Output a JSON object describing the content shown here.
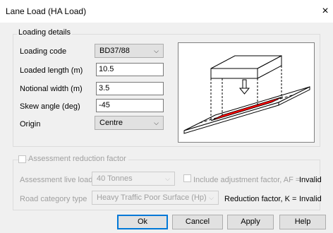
{
  "window": {
    "title": "Lane Load (HA Load)",
    "close_glyph": "×"
  },
  "loading_details": {
    "group_label": "Loading details",
    "loading_code": {
      "label": "Loading code",
      "value": "BD37/88"
    },
    "loaded_length": {
      "label": "Loaded length (m)",
      "value": "10.5"
    },
    "notional_width": {
      "label": "Notional width (m)",
      "value": "3.5"
    },
    "skew_angle": {
      "label": "Skew angle (deg)",
      "value": "-45"
    },
    "origin": {
      "label": "Origin",
      "value": "Centre"
    }
  },
  "assessment": {
    "checkbox_label": "Assessment reduction factor",
    "live_load": {
      "label": "Assessment live load",
      "value": "40 Tonnes"
    },
    "adjustment": {
      "label": "Include adjustment factor, AF =",
      "value": "Invalid"
    },
    "road_category": {
      "label": "Road category type",
      "value": "Heavy Traffic Poor Surface (Hp)"
    },
    "reduction": {
      "label": "Reduction factor, K =",
      "value": "Invalid"
    }
  },
  "buttons": {
    "ok": "Ok",
    "cancel": "Cancel",
    "apply": "Apply",
    "help": "Help"
  },
  "colors": {
    "load_patch": "#ff0000",
    "default_button_border": "#0078d7"
  }
}
